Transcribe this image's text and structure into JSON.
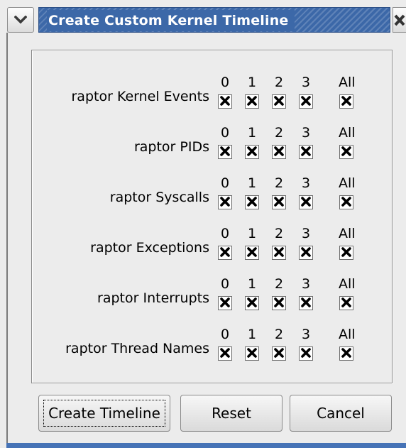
{
  "window": {
    "title": "Create Custom Kernel Timeline"
  },
  "columns": [
    "0",
    "1",
    "2",
    "3",
    "All"
  ],
  "rows": [
    {
      "label": "raptor Kernel Events",
      "checked": [
        true,
        true,
        true,
        true,
        true
      ]
    },
    {
      "label": "raptor PIDs",
      "checked": [
        true,
        true,
        true,
        true,
        true
      ]
    },
    {
      "label": "raptor Syscalls",
      "checked": [
        true,
        true,
        true,
        true,
        true
      ]
    },
    {
      "label": "raptor Exceptions",
      "checked": [
        true,
        true,
        true,
        true,
        true
      ]
    },
    {
      "label": "raptor Interrupts",
      "checked": [
        true,
        true,
        true,
        true,
        true
      ]
    },
    {
      "label": "raptor Thread Names",
      "checked": [
        true,
        true,
        true,
        true,
        true
      ]
    }
  ],
  "buttons": {
    "create_label": "Create Timeline",
    "reset_label": "Reset",
    "cancel_label": "Cancel"
  },
  "colors": {
    "titlebar": "#3c68a8",
    "background": "#ececec"
  },
  "icons": {
    "window_menu": "chevron-down-icon",
    "close": "close-icon",
    "checkbox_mark": "x-mark-icon"
  }
}
